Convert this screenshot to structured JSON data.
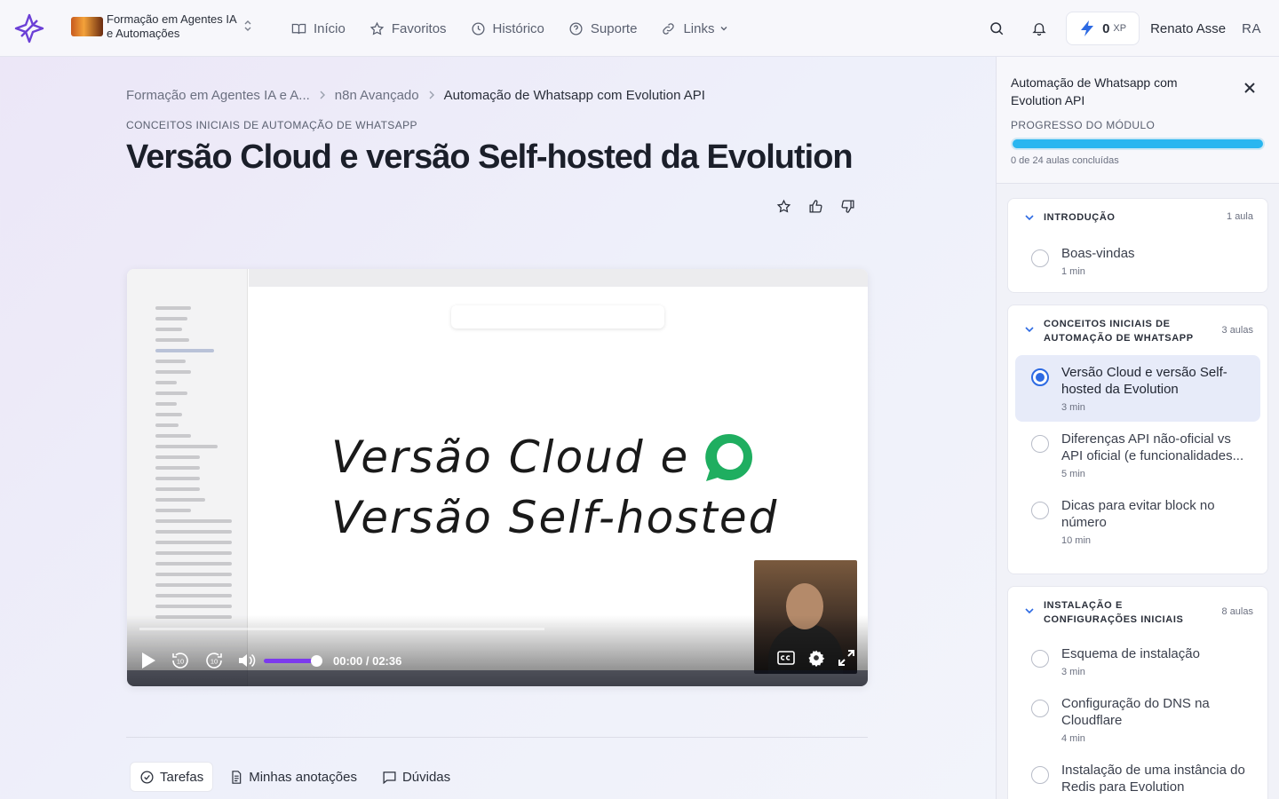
{
  "header": {
    "course_name": "Formação em Agentes IA e Automações",
    "nav": [
      {
        "label": "Início",
        "icon": "book-open-icon"
      },
      {
        "label": "Favoritos",
        "icon": "star-icon"
      },
      {
        "label": "Histórico",
        "icon": "clock-icon"
      },
      {
        "label": "Suporte",
        "icon": "help-circle-icon"
      },
      {
        "label": "Links",
        "icon": "link-icon"
      }
    ],
    "xp_value": "0",
    "xp_unit": "XP",
    "user_name": "Renato Asse",
    "user_initials": "RA",
    "accent": "#2d6ae3"
  },
  "breadcrumb": {
    "items": [
      "Formação em Agentes IA e A...",
      "n8n Avançado",
      "Automação de Whatsapp com Evolution API"
    ]
  },
  "lesson": {
    "section": "CONCEITOS INICIAIS DE AUTOMAÇÃO DE WHATSAPP",
    "title": "Versão Cloud e versão Self-hosted da Evolution"
  },
  "video": {
    "headline_1": "Versão Cloud e",
    "headline_2": "Versão Self-hosted",
    "current_time": "00:00",
    "duration": "02:36",
    "volume": 1.0,
    "progress": 0,
    "skip_back": "10",
    "skip_forward": "10"
  },
  "tabs": [
    {
      "label": "Tarefas",
      "icon": "check-circle-icon"
    },
    {
      "label": "Minhas anotações",
      "icon": "document-icon"
    },
    {
      "label": "Dúvidas",
      "icon": "chat-icon"
    }
  ],
  "panel": {
    "title": "Automação de Whatsapp com Evolution API",
    "progress_label": "PROGRESSO DO MÓDULO",
    "progress_count": "0 de 24 aulas concluídas",
    "progress_bar_color": "#29b6f0",
    "modules": [
      {
        "title": "INTRODUÇÃO",
        "count": "1 aula",
        "lessons": [
          {
            "title": "Boas-vindas",
            "duration": "1 min"
          }
        ]
      },
      {
        "title": "CONCEITOS INICIAIS DE AUTOMAÇÃO DE WHATSAPP",
        "count": "3 aulas",
        "lessons": [
          {
            "title": "Versão Cloud e versão Self-hosted da Evolution",
            "duration": "3 min",
            "active": true
          },
          {
            "title": "Diferenças API não-oficial vs API oficial (e funcionalidades...",
            "duration": "5 min"
          },
          {
            "title": "Dicas para evitar block no número",
            "duration": "10 min"
          }
        ]
      },
      {
        "title": "INSTALAÇÃO E CONFIGURAÇÕES INICIAIS",
        "count": "8 aulas",
        "lessons": [
          {
            "title": "Esquema de instalação",
            "duration": "3 min"
          },
          {
            "title": "Configuração do DNS na Cloudflare",
            "duration": "4 min"
          },
          {
            "title": "Instalação de uma instância do Redis para Evolution",
            "duration": ""
          }
        ]
      }
    ]
  }
}
